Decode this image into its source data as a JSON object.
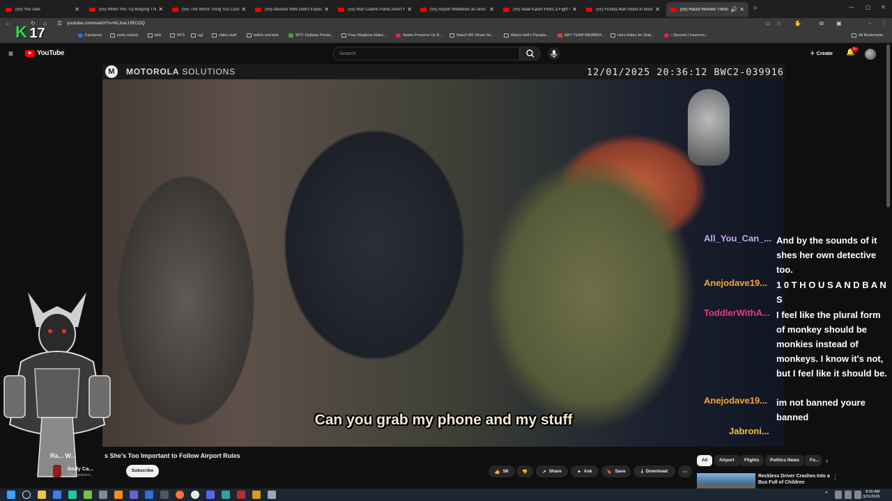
{
  "browser": {
    "tabs": [
      {
        "label": "(55) YouTube",
        "active": false
      },
      {
        "label": "(55) When You Try Bullying The",
        "active": false
      },
      {
        "label": "(55) The Worst Thing You Could",
        "active": false
      },
      {
        "label": "(55) Abusive Wife Didn't Expect",
        "active": false
      },
      {
        "label": "(55) Man Claims Pants Aren't H",
        "active": false
      },
      {
        "label": "(55) Airport Meltdown as Drun",
        "active": false
      },
      {
        "label": "(55) Male Karen Picks a Fight W",
        "active": false
      },
      {
        "label": "(55) Florida Man found in wood",
        "active": false
      },
      {
        "label": "(55) Racist Women Thinks Sh",
        "active": true
      }
    ],
    "url": "youtube.com/watch?v=NLXwLURCOQ",
    "bookmarks": [
      "Facebook",
      "work related",
      "bills",
      "RFS",
      "egl",
      "video stuff",
      "twitch and kick",
      "WTF Outlaws Points...",
      "Free Ringtone Make...",
      "Saints Preserve Us R...",
      "Watch MF Ghost Se...",
      "Watch Hell's Paradis...",
      "ART TEAM MEMBER...",
      "Hero Editor for Diab...",
      "• Discord | #welcom..."
    ],
    "all_bookmarks": "All Bookmarks"
  },
  "youtube": {
    "logo": "YouTube",
    "search_placeholder": "Search",
    "create_label": "Create",
    "notif_count": "9+"
  },
  "video": {
    "brand_left": "MOTOROLA",
    "brand_right": "SOLUTIONS",
    "stamp": "12/01/2025 20:36:12 BWC2-039916",
    "subtitle": "Can you grab my phone and my stuff",
    "title_left": "Ra... W...",
    "title": "s She's Too Important to Follow Airport Rules",
    "channel_name": "Body Ca...",
    "channel_subs": "631K subscri...",
    "subscribe": "Subscribe"
  },
  "actions": {
    "likes": "5K",
    "share": "Share",
    "ask": "Ask",
    "save": "Save",
    "download": "Download"
  },
  "chat": [
    {
      "user": "All_You_Can_...",
      "color": "#c5a8f0",
      "message": "And by the sounds of it shes her own detective too."
    },
    {
      "user": "Anejodave19...",
      "color": "#f3a534",
      "message": "1 0 T H O U S A N D B A N S"
    },
    {
      "user": "ToddlerWithA...",
      "color": "#e83a8c",
      "message": "I feel like the plural form of monkey should be monkies instead of monkeys. I know it's not, but I feel like it should be."
    },
    {
      "user": "Anejodave19...",
      "color": "#f3a534",
      "message": "im not banned youre banned"
    },
    {
      "user": "Jabroni...",
      "color": "#f3c534",
      "message": ""
    }
  ],
  "overlay": {
    "k": "K",
    "num": "17"
  },
  "chips": [
    "All",
    "Airport",
    "Flights",
    "Politics News",
    "Fo..."
  ],
  "recommendation": {
    "title": "Reckless Driver Crashes Into a Bus Full of Children"
  },
  "clock": {
    "time": "8:50 AM",
    "date": "3/31/2026"
  },
  "colors": {
    "accent": "#ff0000",
    "chat_purple": "#c5a8f0",
    "chat_orange": "#f3a534",
    "chat_pink": "#e83a8c"
  }
}
